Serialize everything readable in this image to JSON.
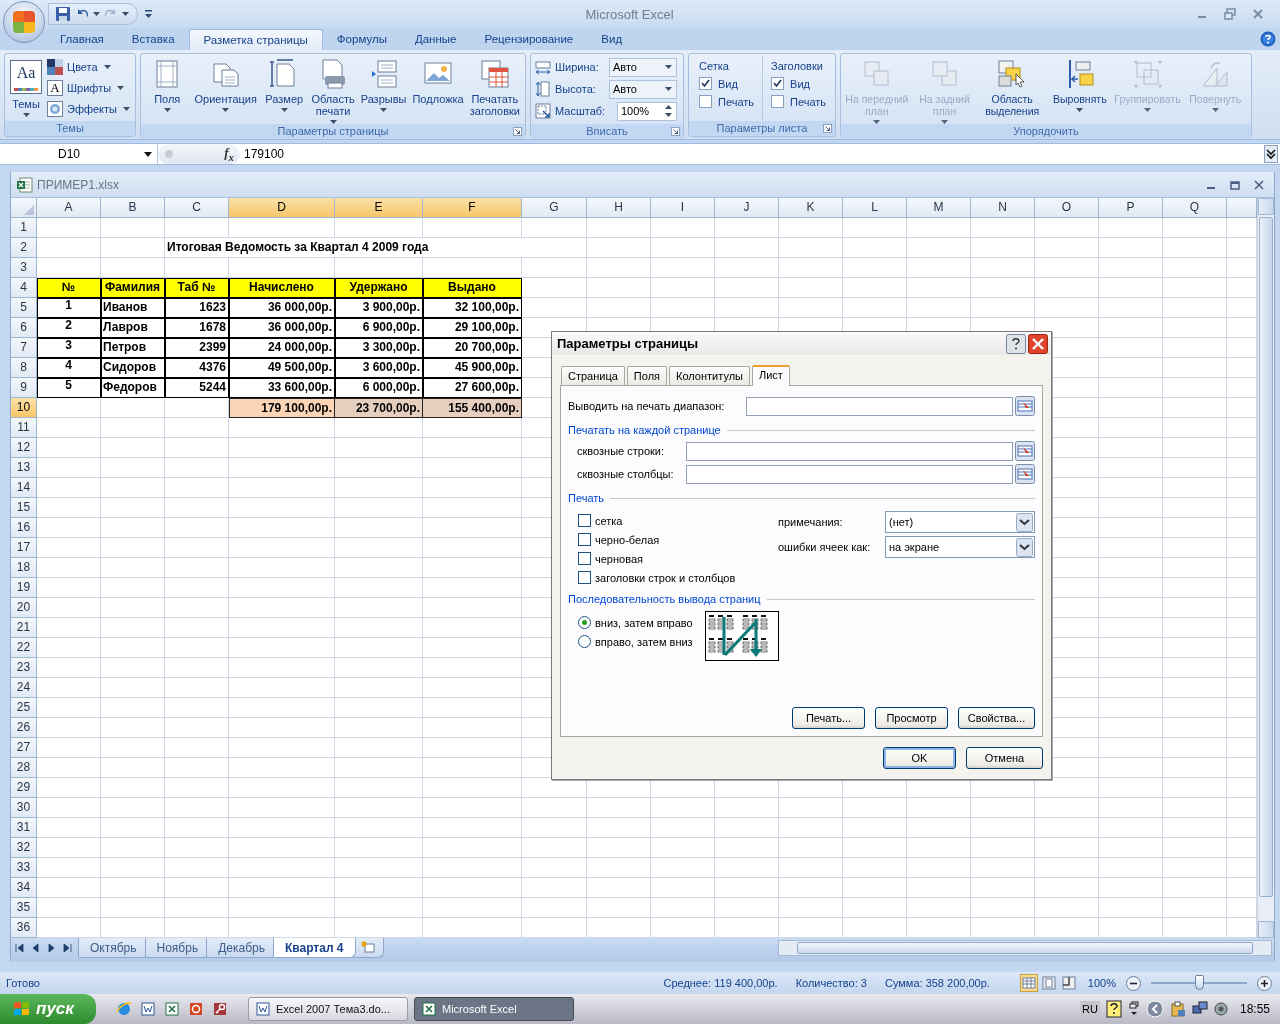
{
  "app": {
    "title": "Microsoft Excel"
  },
  "ribbon_tabs": [
    {
      "label": "Главная",
      "selected": false
    },
    {
      "label": "Вставка",
      "selected": false
    },
    {
      "label": "Разметка страницы",
      "selected": true
    },
    {
      "label": "Формулы",
      "selected": false
    },
    {
      "label": "Данные",
      "selected": false
    },
    {
      "label": "Рецензирование",
      "selected": false
    },
    {
      "label": "Вид",
      "selected": false
    }
  ],
  "ribbon_groups": [
    {
      "label": "Темы",
      "launcher": false,
      "items": [
        {
          "kind": "large",
          "label": "Темы",
          "glyph": "Aa",
          "menu": true,
          "disabled": false
        },
        {
          "kind": "small",
          "label": "Цвета",
          "menu": true
        },
        {
          "kind": "small",
          "label": "Шрифты",
          "glyph": "A",
          "menu": true
        },
        {
          "kind": "small",
          "label": "Эффекты",
          "menu": true
        }
      ]
    },
    {
      "label": "Параметры страницы",
      "launcher": true,
      "items": [
        {
          "kind": "large",
          "label": "Поля",
          "menu": true,
          "disabled": false
        },
        {
          "kind": "large",
          "label": "Ориентация",
          "menu": true,
          "disabled": false
        },
        {
          "kind": "large",
          "label": "Размер",
          "menu": true,
          "disabled": false
        },
        {
          "kind": "large",
          "label": "Область печати",
          "menu": true,
          "disabled": false
        },
        {
          "kind": "large",
          "label": "Разрывы",
          "menu": true,
          "disabled": false
        },
        {
          "kind": "large",
          "label": "Подложка",
          "menu": false,
          "disabled": false
        },
        {
          "kind": "large",
          "label": "Печатать заголовки",
          "menu": false,
          "disabled": false
        }
      ]
    },
    {
      "label": "Вписать",
      "launcher": true,
      "items": [
        {
          "kind": "dropdown",
          "label": "Ширина:",
          "value": "Авто"
        },
        {
          "kind": "dropdown",
          "label": "Высота:",
          "value": "Авто"
        },
        {
          "kind": "spinner",
          "label": "Масштаб:",
          "value": "100%"
        }
      ]
    },
    {
      "label": "Параметры листа",
      "launcher": true,
      "items": [
        {
          "kind": "column",
          "label": "Сетка",
          "checks": [
            {
              "label": "Вид",
              "checked": true
            },
            {
              "label": "Печать",
              "checked": false
            }
          ]
        },
        {
          "kind": "column",
          "label": "Заголовки",
          "checks": [
            {
              "label": "Вид",
              "checked": true
            },
            {
              "label": "Печать",
              "checked": false
            }
          ]
        }
      ]
    },
    {
      "label": "Упорядочить",
      "launcher": false,
      "items": [
        {
          "kind": "large",
          "label": "На передний план",
          "menu": true,
          "disabled": true
        },
        {
          "kind": "large",
          "label": "На задний план",
          "menu": true,
          "disabled": true
        },
        {
          "kind": "large",
          "label": "Область выделения",
          "menu": false,
          "disabled": false
        },
        {
          "kind": "large",
          "label": "Выровнять",
          "menu": true,
          "disabled": false
        },
        {
          "kind": "large",
          "label": "Группировать",
          "menu": true,
          "disabled": true
        },
        {
          "kind": "large",
          "label": "Повернуть",
          "menu": true,
          "disabled": true
        }
      ]
    }
  ],
  "formula_bar": {
    "name_box": "D10",
    "function_button": "f$_{x}$",
    "value": "179100"
  },
  "workbook": {
    "title": "ПРИМЕР1.xlsx"
  },
  "sheet": {
    "columns": [
      {
        "label": "A",
        "selected": false
      },
      {
        "label": "B",
        "selected": false
      },
      {
        "label": "C",
        "selected": false
      },
      {
        "label": "D",
        "selected": true
      },
      {
        "label": "E",
        "selected": true
      },
      {
        "label": "F",
        "selected": true
      },
      {
        "label": "G",
        "selected": false
      },
      {
        "label": "H",
        "selected": false
      },
      {
        "label": "I",
        "selected": false
      },
      {
        "label": "J",
        "selected": false
      },
      {
        "label": "K",
        "selected": false
      },
      {
        "label": "L",
        "selected": false
      },
      {
        "label": "M",
        "selected": false
      },
      {
        "label": "N",
        "selected": false
      },
      {
        "label": "O",
        "selected": false
      },
      {
        "label": "P",
        "selected": false
      },
      {
        "label": "Q",
        "selected": false
      }
    ],
    "rows": [
      {
        "label": "1",
        "selected": false
      },
      {
        "label": "2",
        "selected": false
      },
      {
        "label": "3",
        "selected": false
      },
      {
        "label": "4",
        "selected": false
      },
      {
        "label": "5",
        "selected": false
      },
      {
        "label": "6",
        "selected": false
      },
      {
        "label": "7",
        "selected": false
      },
      {
        "label": "8",
        "selected": false
      },
      {
        "label": "9",
        "selected": false
      },
      {
        "label": "10",
        "selected": true
      },
      {
        "label": "11",
        "selected": false
      },
      {
        "label": "12",
        "selected": false
      },
      {
        "label": "13",
        "selected": false
      },
      {
        "label": "14",
        "selected": false
      },
      {
        "label": "15",
        "selected": false
      },
      {
        "label": "16",
        "selected": false
      },
      {
        "label": "17",
        "selected": false
      },
      {
        "label": "18",
        "selected": false
      },
      {
        "label": "19",
        "selected": false
      },
      {
        "label": "20",
        "selected": false
      },
      {
        "label": "21",
        "selected": false
      },
      {
        "label": "22",
        "selected": false
      },
      {
        "label": "23",
        "selected": false
      },
      {
        "label": "24",
        "selected": false
      },
      {
        "label": "25",
        "selected": false
      },
      {
        "label": "26",
        "selected": false
      },
      {
        "label": "27",
        "selected": false
      },
      {
        "label": "28",
        "selected": false
      },
      {
        "label": "29",
        "selected": false
      },
      {
        "label": "30",
        "selected": false
      },
      {
        "label": "31",
        "selected": false
      },
      {
        "label": "32",
        "selected": false
      },
      {
        "label": "33",
        "selected": false
      },
      {
        "label": "34",
        "selected": false
      },
      {
        "label": "35",
        "selected": false
      },
      {
        "label": "36",
        "selected": false
      }
    ],
    "title": "Итоговая Ведомость за Квартал 4 2009 года",
    "table": {
      "columns": [
        "№",
        "Фамилия",
        "Таб №",
        "Начислено",
        "Удержано",
        "Выдано"
      ],
      "rows": [
        [
          "1",
          "Иванов",
          "1623",
          "36 000,00р.",
          "3 900,00р.",
          "32 100,00р."
        ],
        [
          "2",
          "Лавров",
          "1678",
          "36 000,00р.",
          "6 900,00р.",
          "29 100,00р."
        ],
        [
          "3",
          "Петров",
          "2399",
          "24 000,00р.",
          "3 300,00р.",
          "20 700,00р."
        ],
        [
          "4",
          "Сидоров",
          "4376",
          "49 500,00р.",
          "3 600,00р.",
          "45 900,00р."
        ],
        [
          "5",
          "Федоров",
          "5244",
          "33 600,00р.",
          "6 000,00р.",
          "27 600,00р."
        ]
      ],
      "totals": [
        {
          "text": "179 100,00р.",
          "active": true
        },
        {
          "text": "23 700,00р.",
          "active": false
        },
        {
          "text": "155 400,00р.",
          "active": false
        }
      ]
    }
  },
  "sheet_tabs": [
    {
      "label": "Октябрь",
      "selected": false
    },
    {
      "label": "Ноябрь",
      "selected": false
    },
    {
      "label": "Декабрь",
      "selected": false
    },
    {
      "label": "Квартал 4",
      "selected": true
    }
  ],
  "status_bar": {
    "state": "Готово",
    "stats": [
      "Среднее:  119 400,00р.",
      "Количество: 3",
      "Сумма:  358 200,00р."
    ],
    "views": [
      {
        "selected": true
      },
      {
        "selected": false
      },
      {
        "selected": false
      }
    ],
    "zoom": "100%",
    "zoom_slider": {
      "level": 0.5
    }
  },
  "dialog": {
    "title": "Параметры страницы",
    "tabs": [
      {
        "label": "Страница",
        "selected": false
      },
      {
        "label": "Поля",
        "selected": false
      },
      {
        "label": "Колонтитулы",
        "selected": false
      },
      {
        "label": "Лист",
        "selected": true
      }
    ],
    "print_area_label": "Выводить на печать диапазон:",
    "repeat_section": "Печатать на каждой странице",
    "repeat_fields": [
      "сквозные строки:",
      "сквозные столбцы:"
    ],
    "print_section": "Печать",
    "print_options": [
      {
        "label": "сетка",
        "checked": false
      },
      {
        "label": "черно-белая",
        "checked": false
      },
      {
        "label": "черновая",
        "checked": false
      },
      {
        "label": "заголовки строк и столбцов",
        "checked": false
      }
    ],
    "selects": [
      {
        "label": "примечания:",
        "value": "(нет)"
      },
      {
        "label": "ошибки ячеек как:",
        "value": "на экране"
      }
    ],
    "order_section": "Последовательность вывода страниц",
    "order_options": [
      {
        "label": "вниз, затем вправо",
        "selected": true
      },
      {
        "label": "вправо, затем вниз",
        "selected": false
      }
    ],
    "panel_buttons": [
      "Печать...",
      "Просмотр",
      "Свойства..."
    ],
    "buttons": [
      "OK",
      "Отмена"
    ]
  },
  "taskbar": {
    "start": "пуск",
    "tasks": [
      {
        "label": "Excel 2007 Тема3.do...",
        "selected": false
      },
      {
        "label": "Microsoft Excel",
        "selected": true
      }
    ],
    "language": "RU",
    "clock": "18:55"
  }
}
